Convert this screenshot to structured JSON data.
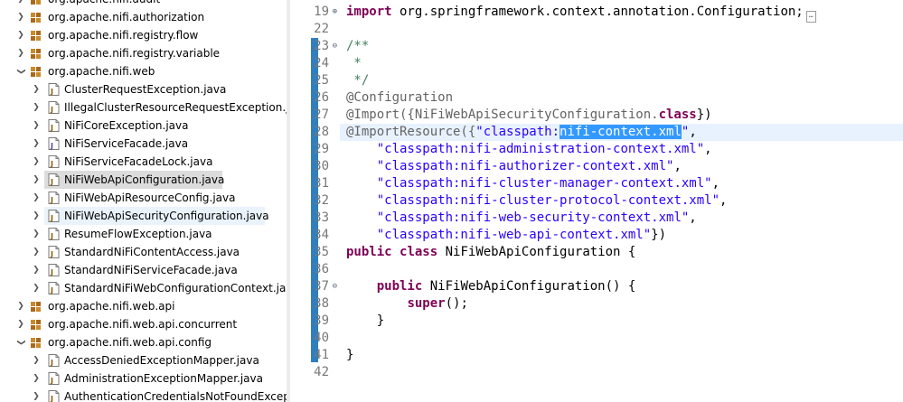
{
  "explorer": {
    "items": [
      {
        "label": "org.apache.nifi.audit",
        "type": "package",
        "expanded": false
      },
      {
        "label": "org.apache.nifi.authorization",
        "type": "package",
        "expanded": false
      },
      {
        "label": "org.apache.nifi.registry.flow",
        "type": "package",
        "expanded": false
      },
      {
        "label": "org.apache.nifi.registry.variable",
        "type": "package",
        "expanded": false
      },
      {
        "label": "org.apache.nifi.web",
        "type": "package",
        "expanded": true
      },
      {
        "label": "ClusterRequestException.java",
        "type": "java"
      },
      {
        "label": "IllegalClusterResourceRequestException.java",
        "type": "java"
      },
      {
        "label": "NiFiCoreException.java",
        "type": "java"
      },
      {
        "label": "NiFiServiceFacade.java",
        "type": "java-interface"
      },
      {
        "label": "NiFiServiceFacadeLock.java",
        "type": "java"
      },
      {
        "label": "NiFiWebApiConfiguration.java",
        "type": "java",
        "selected": true
      },
      {
        "label": "NiFiWebApiResourceConfig.java",
        "type": "java"
      },
      {
        "label": "NiFiWebApiSecurityConfiguration.java",
        "type": "java",
        "hover": true
      },
      {
        "label": "ResumeFlowException.java",
        "type": "java"
      },
      {
        "label": "StandardNiFiContentAccess.java",
        "type": "java"
      },
      {
        "label": "StandardNiFiServiceFacade.java",
        "type": "java"
      },
      {
        "label": "StandardNiFiWebConfigurationContext.java",
        "type": "java"
      },
      {
        "label": "org.apache.nifi.web.api",
        "type": "package",
        "expanded": false
      },
      {
        "label": "org.apache.nifi.web.api.concurrent",
        "type": "package",
        "expanded": false
      },
      {
        "label": "org.apache.nifi.web.api.config",
        "type": "package",
        "expanded": true
      },
      {
        "label": "AccessDeniedExceptionMapper.java",
        "type": "java"
      },
      {
        "label": "AdministrationExceptionMapper.java",
        "type": "java"
      },
      {
        "label": "AuthenticationCredentialsNotFoundExceptionMapper.java",
        "type": "java"
      }
    ]
  },
  "editor": {
    "line_numbers": [
      "19",
      "22",
      "23",
      "24",
      "25",
      "26",
      "27",
      "28",
      "29",
      "30",
      "31",
      "32",
      "33",
      "34",
      "35",
      "36",
      "37",
      "38",
      "39",
      "40",
      "41",
      "42"
    ],
    "code": {
      "l19": {
        "kw": "import",
        "rest": " org.springframework.context.annotation.Configuration;"
      },
      "l23": "/**",
      "l24": " *",
      "l25": " */",
      "l26": "@Configuration",
      "l27": {
        "ann": "@Import({NiFiWebApiSecurityConfiguration.",
        "kw": "class",
        "end": "})"
      },
      "l28": {
        "ann": "@ImportResource({",
        "str_a": "\"classpath:",
        "selected": "nifi-context.xml",
        "str_b": "\"",
        "end": ","
      },
      "l29": {
        "str": "\"classpath:nifi-administration-context.xml\"",
        "end": ","
      },
      "l30": {
        "str": "\"classpath:nifi-authorizer-context.xml\"",
        "end": ","
      },
      "l31": {
        "str": "\"classpath:nifi-cluster-manager-context.xml\"",
        "end": ","
      },
      "l32": {
        "str": "\"classpath:nifi-cluster-protocol-context.xml\"",
        "end": ","
      },
      "l33": {
        "str": "\"classpath:nifi-web-security-context.xml\"",
        "end": ","
      },
      "l34": {
        "str": "\"classpath:nifi-web-api-context.xml\"",
        "end": "})"
      },
      "l35": {
        "kw1": "public",
        "kw2": "class",
        "rest": " NiFiWebApiConfiguration {"
      },
      "l37": {
        "kw": "public",
        "rest": " NiFiWebApiConfiguration() {"
      },
      "l38": {
        "kw": "super",
        "rest": "();"
      },
      "l39": "}",
      "l41": "}"
    }
  },
  "colors": {
    "keyword": "#7f0055",
    "string": "#2a00ff",
    "comment": "#3f7f5f",
    "annotation": "#646464",
    "selection": "#3399ff",
    "current_line": "#e8f2fe",
    "change_bar": "#2f7fbf"
  }
}
